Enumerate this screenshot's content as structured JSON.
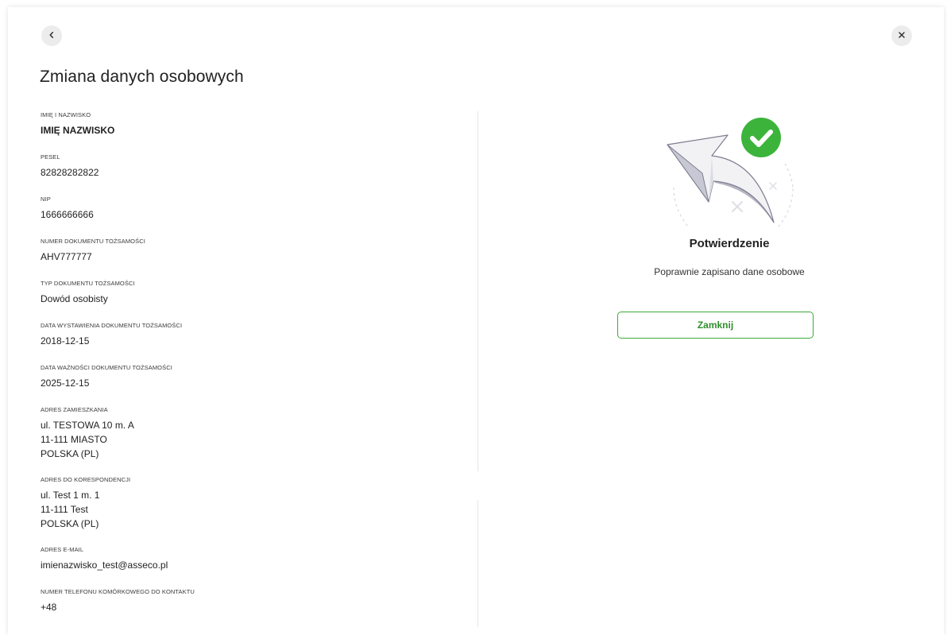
{
  "header": {
    "title": "Zmiana danych osobowych",
    "back_icon": "chevron-left-icon",
    "close_icon": "close-icon"
  },
  "fields": [
    {
      "label": "IMIĘ I NAZWISKO",
      "value": "IMIĘ NAZWISKO"
    },
    {
      "label": "PESEL",
      "value": "82828282822"
    },
    {
      "label": "NIP",
      "value": "1666666666"
    },
    {
      "label": "NUMER DOKUMENTU TOŻSAMOŚCI",
      "value": "AHV777777"
    },
    {
      "label": "TYP DOKUMENTU TOŻSAMOŚCI",
      "value": "Dowód osobisty"
    },
    {
      "label": "DATA WYSTAWIENIA DOKUMENTU TOŻSAMOŚCI",
      "value": "2018-12-15"
    },
    {
      "label": "DATA WAŻNOŚCI DOKUMENTU TOŻSAMOŚCI",
      "value": "2025-12-15"
    },
    {
      "label": "ADRES ZAMIESZKANIA",
      "lines": [
        "ul. TESTOWA 10 m. A",
        "11-111 MIASTO",
        "POLSKA (PL)"
      ]
    },
    {
      "label": "ADRES DO KORESPONDENCJI",
      "lines": [
        "ul. Test 1 m. 1",
        "11-111 Test",
        "POLSKA (PL)"
      ]
    },
    {
      "label": "ADRES E-MAIL",
      "value": "imienazwisko_test@asseco.pl"
    },
    {
      "label": "NUMER TELEFONU KOMÓRKOWEGO DO KONTAKTU",
      "value": "+48"
    }
  ],
  "confirmation": {
    "illustration": "success-arrow-illustration",
    "badge_icon": "check-circle-icon",
    "title": "Potwierdzenie",
    "message": "Poprawnie zapisano dane osobowe",
    "button_label": "Zamknij"
  },
  "colors": {
    "accent_green": "#3aaa35",
    "check_badge": "#3cb43c",
    "arrow_fill": "#f1f1f3",
    "arrow_shade": "#a6a6b4"
  }
}
